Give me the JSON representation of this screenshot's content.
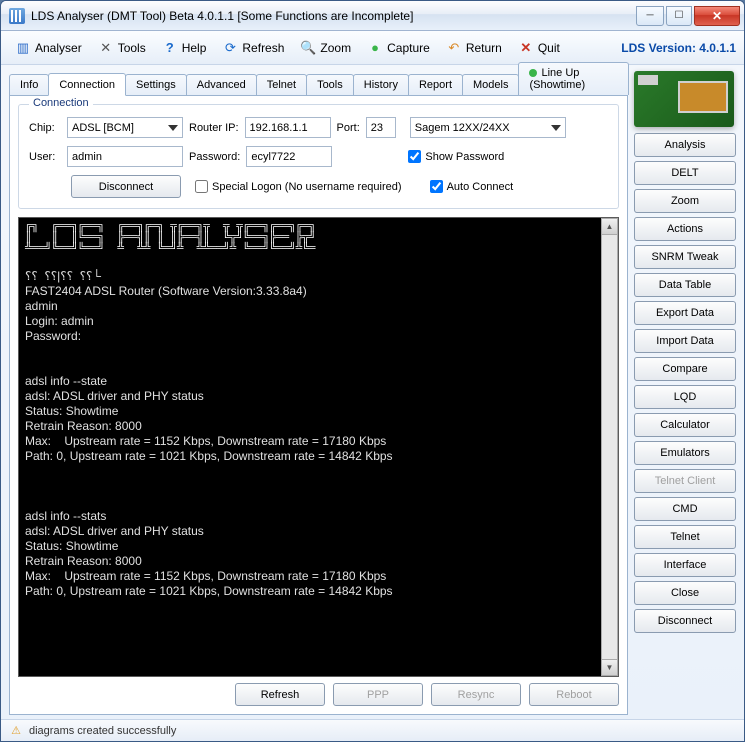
{
  "window": {
    "title": "LDS Analyser (DMT Tool) Beta 4.0.1.1 [Some Functions are Incomplete]"
  },
  "toolbar": {
    "analyser": "Analyser",
    "tools": "Tools",
    "help": "Help",
    "refresh": "Refresh",
    "zoom": "Zoom",
    "capture": "Capture",
    "return": "Return",
    "quit": "Quit",
    "version": "LDS Version: 4.0.1.1"
  },
  "tabs": {
    "info": "Info",
    "connection": "Connection",
    "settings": "Settings",
    "advanced": "Advanced",
    "telnet": "Telnet",
    "tools": "Tools",
    "history": "History",
    "report": "Report",
    "models": "Models",
    "lineup": "Line Up (Showtime)"
  },
  "connection": {
    "legend": "Connection",
    "chip_label": "Chip:",
    "chip_value": "ADSL [BCM]",
    "router_ip_label": "Router IP:",
    "router_ip_value": "192.168.1.1",
    "port_label": "Port:",
    "port_value": "23",
    "model_value": "Sagem 12XX/24XX",
    "user_label": "User:",
    "user_value": "admin",
    "password_label": "Password:",
    "password_value": "ecyl7722",
    "show_password": "Show Password",
    "disconnect": "Disconnect",
    "special_logon": "Special Logon (No username required)",
    "auto_connect": "Auto Connect"
  },
  "terminal": {
    "ascii_art": "╔╗  ╔══╗╔══╗  ╔══╗╔═╗ ╦╔══╗╦  ╦ ╦╔══╗╔══╗╔═╗\n║   ║  ║╚══╗  ╠══╣║ ║ ║╠══╣║  ╚╦╝╚══╗╠══ ╠╦╝\n╩══╝╚══╝╚══╝  ╩  ╩╩ ╚═╝╩  ╩╩══╝╩ ╚══╝╚══╝╩╚═",
    "body": "⸮⸮  ⸮⸮|⸮⸮  ⸮⸮└\nFAST2404 ADSL Router (Software Version:3.33.8a4)\nadmin\nLogin: admin\nPassword:\n\n\nadsl info --state\nadsl: ADSL driver and PHY status\nStatus: Showtime\nRetrain Reason: 8000\nMax:    Upstream rate = 1152 Kbps, Downstream rate = 17180 Kbps\nPath: 0, Upstream rate = 1021 Kbps, Downstream rate = 14842 Kbps\n\n\n\nadsl info --stats\nadsl: ADSL driver and PHY status\nStatus: Showtime\nRetrain Reason: 8000\nMax:    Upstream rate = 1152 Kbps, Downstream rate = 17180 Kbps\nPath: 0, Upstream rate = 1021 Kbps, Downstream rate = 14842 Kbps"
  },
  "bottom": {
    "refresh": "Refresh",
    "ppp": "PPP",
    "resync": "Resync",
    "reboot": "Reboot"
  },
  "side": {
    "analysis": "Analysis",
    "delt": "DELT",
    "zoom": "Zoom",
    "actions": "Actions",
    "snrm_tweak": "SNRM Tweak",
    "data_table": "Data Table",
    "export_data": "Export Data",
    "import_data": "Import Data",
    "compare": "Compare",
    "lqd": "LQD",
    "calculator": "Calculator",
    "emulators": "Emulators",
    "telnet_client": "Telnet Client",
    "cmd": "CMD",
    "telnet": "Telnet",
    "interface": "Interface",
    "close": "Close",
    "disconnect": "Disconnect"
  },
  "status": {
    "message": "diagrams created successfully"
  }
}
